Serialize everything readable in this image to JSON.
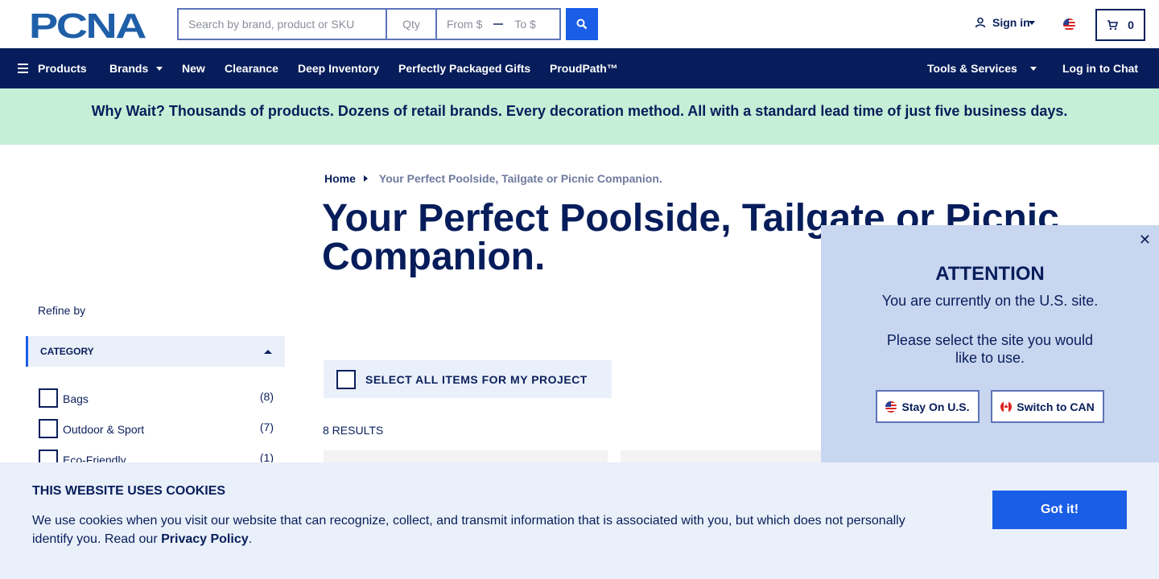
{
  "header": {
    "logo_text": "PCNA",
    "search": {
      "keyword_placeholder": "Search by brand, product or SKU",
      "qty_placeholder": "Qty",
      "price_from_placeholder": "From $",
      "price_to_placeholder": "To $"
    },
    "sign_in_label": "Sign in",
    "cart_count": "0"
  },
  "nav": {
    "products": "Products",
    "brands": "Brands",
    "new": "New",
    "clearance": "Clearance",
    "deep_inventory": "Deep Inventory",
    "gifts": "Perfectly Packaged Gifts",
    "proudpath": "ProudPath™",
    "tools": "Tools & Services",
    "chat": "Log in to Chat"
  },
  "promo": "Why Wait? Thousands of products. Dozens of retail brands. Every decoration method. All with a standard lead time of just five business days.",
  "breadcrumb": {
    "home": "Home",
    "current": "Your Perfect Poolside, Tailgate or Picnic Companion."
  },
  "page_title": "Your Perfect Poolside, Tailgate or Picnic Companion.",
  "sidebar": {
    "refine_label": "Refine by",
    "category_header": "CATEGORY",
    "filters": [
      {
        "label": "Bags",
        "count": "(8)"
      },
      {
        "label": "Outdoor & Sport",
        "count": "(7)"
      },
      {
        "label": "Eco-Friendly",
        "count": "(1)"
      }
    ]
  },
  "listing": {
    "select_all": "SELECT ALL ITEMS FOR MY PROJECT",
    "results": "8 RESULTS"
  },
  "attention": {
    "close": "✕",
    "title": "ATTENTION",
    "line1": "You are currently on the U.S. site.",
    "line2": "Please select the site you would like to use.",
    "stay_label": "Stay On U.S.",
    "switch_label": "Switch to CAN"
  },
  "cookie": {
    "title": "THIS WEBSITE USES COOKIES",
    "text": "We use cookies when you visit our website that can recognize, collect, and transmit information that is associated with you, but which does not personally identify you. Read our ",
    "link": "Privacy Policy",
    "end": ".",
    "button": "Got it!"
  },
  "colors": {
    "navy": "#071d5b",
    "accent_blue": "#1a5de6",
    "promo_bg": "#c5efd6",
    "modal_bg": "#c9d6ef",
    "cookie_bg": "#eaf0f9"
  }
}
